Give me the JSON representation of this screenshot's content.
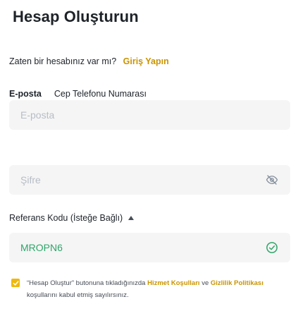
{
  "header": {
    "title": "Hesap Oluşturun"
  },
  "login": {
    "prompt": "Zaten bir hesabınız var mı?",
    "link": "Giriş Yapın"
  },
  "tabs": [
    {
      "label": "E-posta",
      "active": true
    },
    {
      "label": "Cep Telefonu Numarası",
      "active": false
    }
  ],
  "form": {
    "email": {
      "placeholder": "E-posta",
      "value": ""
    },
    "password": {
      "placeholder": "Şifre",
      "value": "",
      "toggle_icon": "eye-off-icon"
    },
    "referral": {
      "label": "Referans Kodu (İsteğe Bağlı)",
      "value": "MROPN6",
      "status_icon": "check-circle-icon",
      "caret_icon": "caret-up-icon"
    }
  },
  "terms": {
    "checked": true,
    "part1": "“Hesap Oluştur” butonuna tıkladığınızda",
    "link1": "Hizmet Koşulları",
    "part2": "ve",
    "link2": "Gizlilik Politikası",
    "part3": "koşullarını kabul etmiş sayılırsınız."
  },
  "colors": {
    "accent": "#f0b90b",
    "link": "#c99400",
    "success": "#2ea56a",
    "field_bg": "#f5f5f5",
    "placeholder": "#b7bdc6"
  }
}
